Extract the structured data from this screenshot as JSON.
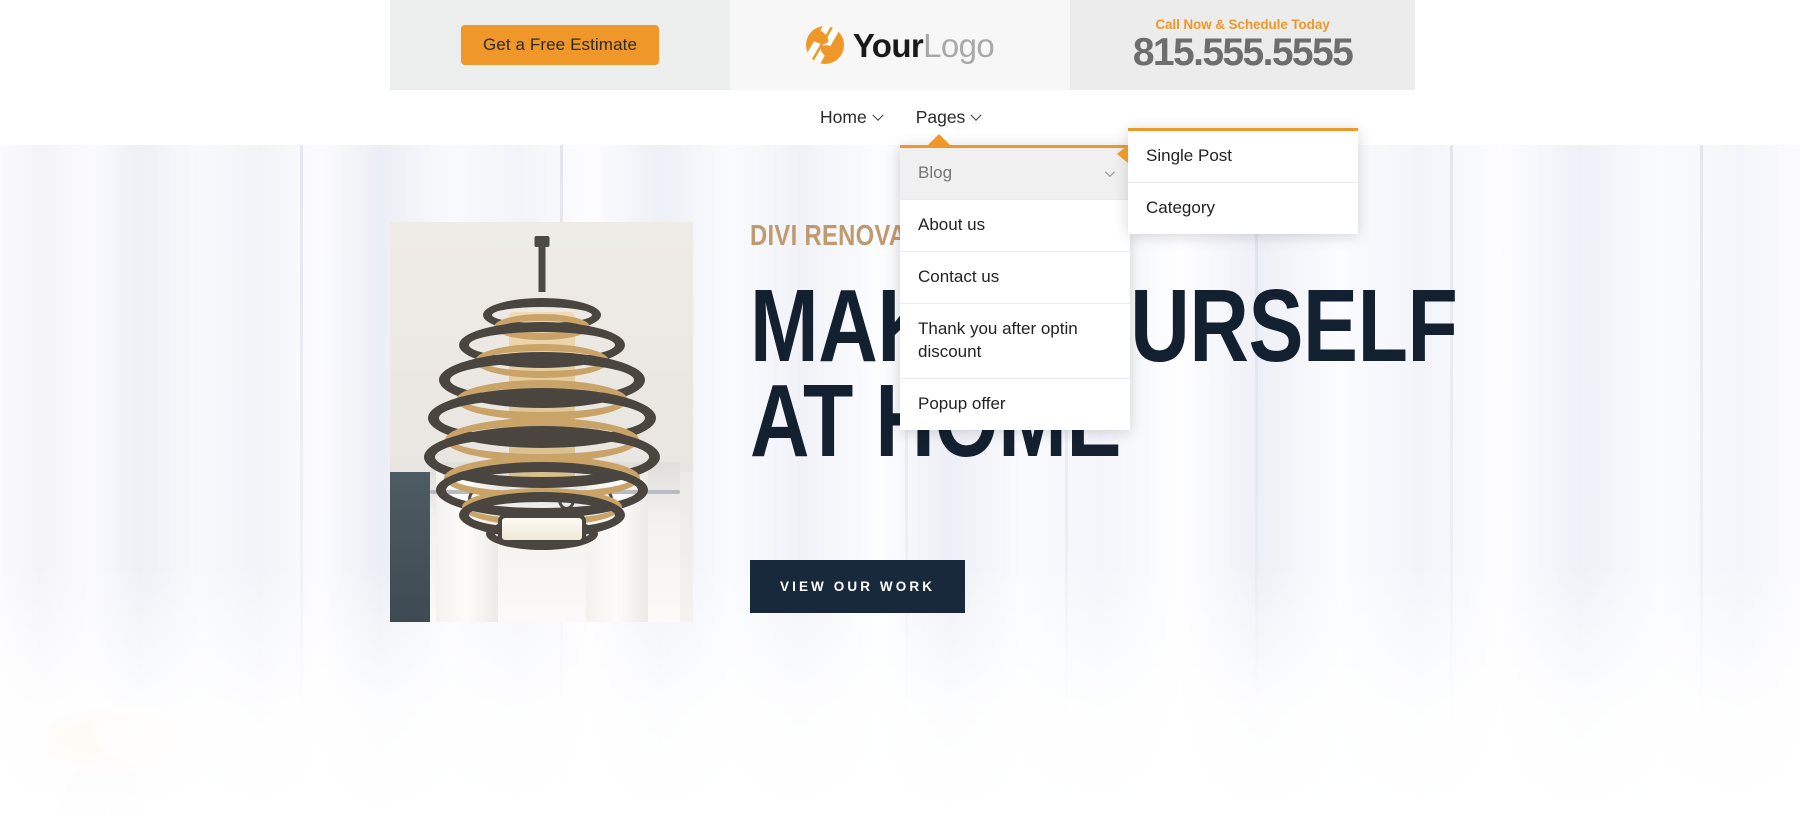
{
  "header": {
    "estimate_button": "Get a Free Estimate",
    "logo": {
      "primary": "Your",
      "secondary": "Logo",
      "icon": "swirl-logo-icon"
    },
    "phone": {
      "tagline": "Call Now & Schedule Today",
      "number": "815.555.5555"
    }
  },
  "nav": {
    "items": [
      {
        "label": "Home",
        "has_dropdown": true
      },
      {
        "label": "Pages",
        "has_dropdown": true
      }
    ]
  },
  "dropdown": {
    "items": [
      {
        "label": "Blog",
        "active": true,
        "has_submenu": true
      },
      {
        "label": "About us",
        "active": false,
        "has_submenu": false
      },
      {
        "label": "Contact us",
        "active": false,
        "has_submenu": false
      },
      {
        "label": "Thank you after optin discount",
        "active": false,
        "has_submenu": false
      },
      {
        "label": "Popup offer",
        "active": false,
        "has_submenu": false
      }
    ]
  },
  "submenu": {
    "items": [
      {
        "label": "Single Post"
      },
      {
        "label": "Category"
      }
    ]
  },
  "hero": {
    "eyebrow": "DIVI RENOVATION",
    "headline": "MAKE YOURSELF\nAT HOME",
    "cta": "VIEW OUR WORK",
    "image_alt": "spiral-chandelier-photo"
  },
  "colors": {
    "accent_orange": "#ef9829",
    "headline_navy": "#132030",
    "eyebrow_tan": "#c09a6f",
    "phone_gray": "#6d6d6d",
    "button_dark": "#17293a"
  }
}
